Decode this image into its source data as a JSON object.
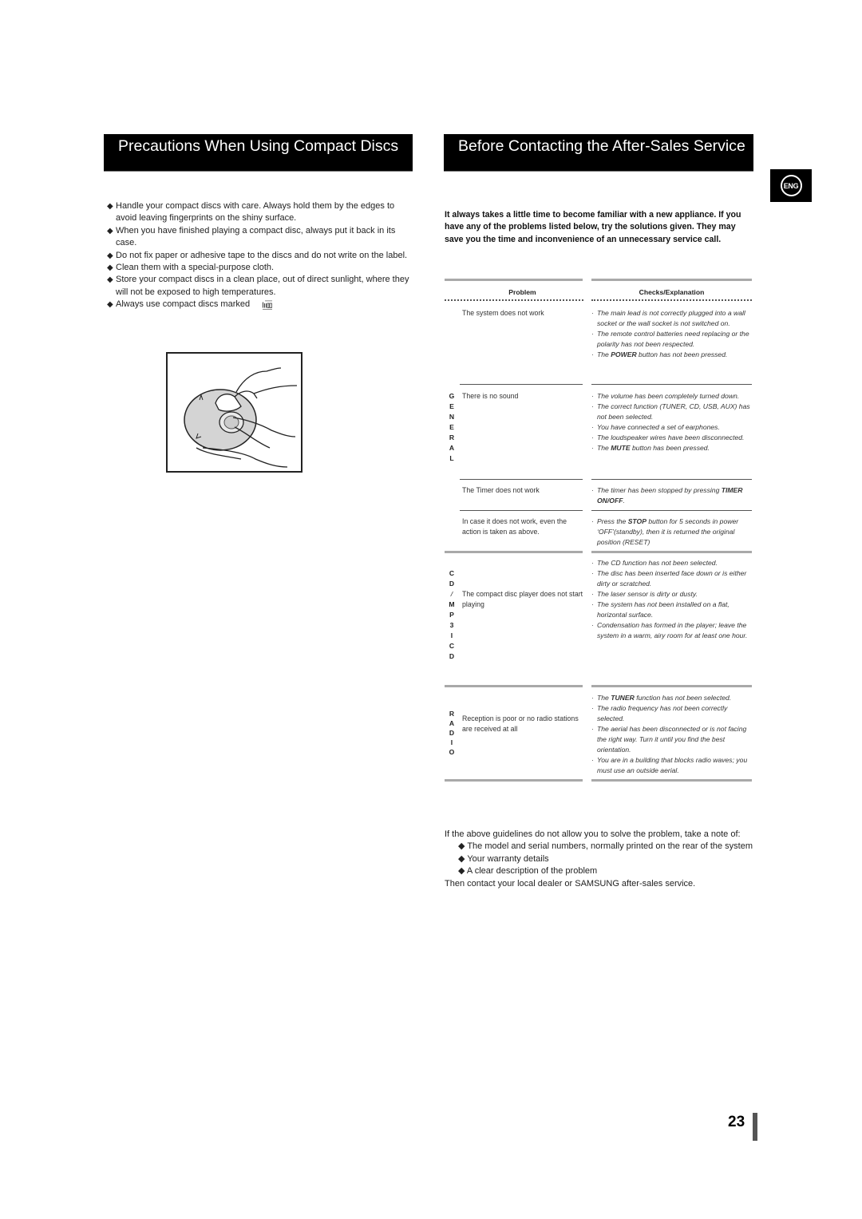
{
  "left_section": {
    "title": "Precautions When Using Compact Discs",
    "bullets": [
      "Handle your compact discs with care. Always hold them by the edges to avoid leaving fingerprints on the shiny surface.",
      "When you have finished playing a compact disc, always put it back in its case.",
      "Do not fix paper or adhesive tape to the discs and do not write on the label.",
      "Clean them with a special-purpose cloth.",
      "Store your compact discs in a clean place, out of direct sunlight, where they will not be exposed to high temperatures.",
      "Always use compact discs marked"
    ],
    "cd_logo": {
      "top": "COMPACT",
      "main": "disc",
      "bottom": "DIGITAL AUDIO"
    },
    "illustration": "hands-cleaning-disc"
  },
  "right_section": {
    "title": "Before Contacting the After-Sales Service",
    "language_badge": "ENG",
    "intro": "It always takes a little time to become familiar with a new appliance. If you have any of the problems listed below, try the solutions given. They may save you the time and inconvenience of an unnecessary service call.",
    "table": {
      "headers": {
        "problem": "Problem",
        "checks": "Checks/Explanation"
      },
      "groups": [
        {
          "label": "",
          "rows": [
            {
              "problem": "The system does not work",
              "checks": [
                "The main lead is not correctly plugged into a wall socket or the wall socket is not switched on.",
                "The remote control batteries need replacing or the polarity has not been respected.",
                "The POWER button has not been pressed."
              ]
            }
          ]
        },
        {
          "label": "GENERAL",
          "rows": [
            {
              "problem": "There is no sound",
              "checks": [
                "The volume has been completely turned down.",
                "The correct function (TUNER, CD, USB, AUX) has not been selected.",
                "You have connected a set of earphones.",
                "The loudspeaker wires have been disconnected.",
                "The MUTE button has been pressed."
              ]
            },
            {
              "problem": "The Timer does not work",
              "checks": [
                "The timer has been stopped by pressing TIMER ON/OFF."
              ]
            },
            {
              "problem": "In case it does not work, even the action is taken as above.",
              "checks": [
                "Press the STOP button for 5 seconds in power ‘OFF’(standby), then it is returned the original position (RESET)"
              ]
            }
          ]
        },
        {
          "label": "CD/MP3 ICD",
          "rows": [
            {
              "problem": "The compact disc player does not start playing",
              "checks": [
                "The CD function has not been selected.",
                "The disc has been inserted face down or is either dirty or scratched.",
                "The laser sensor is dirty or dusty.",
                "The system has not been installed on a flat, horizontal surface.",
                "Condensation has formed in the player; leave the system in a warm, airy room for at least one hour."
              ]
            }
          ]
        },
        {
          "label": "RADIO",
          "rows": [
            {
              "problem": "Reception is poor or no radio stations are received at all",
              "checks": [
                "The TUNER function has not been selected.",
                "The radio frequency has not been correctly selected.",
                "The aerial has been disconnected or is not facing the right way. Turn it until you find the best orientation.",
                "You are in a building that blocks radio waves; you must use an outside aerial."
              ]
            }
          ]
        }
      ]
    },
    "outro": {
      "lead": "If the above guidelines do not allow you to solve the problem, take a note of:",
      "items": [
        "The model and serial numbers, normally printed on the rear of  the system",
        "Your warranty details",
        "A clear description of the problem"
      ],
      "closing": "Then contact your local dealer or SAMSUNG after-sales service."
    }
  },
  "page_number": "23"
}
